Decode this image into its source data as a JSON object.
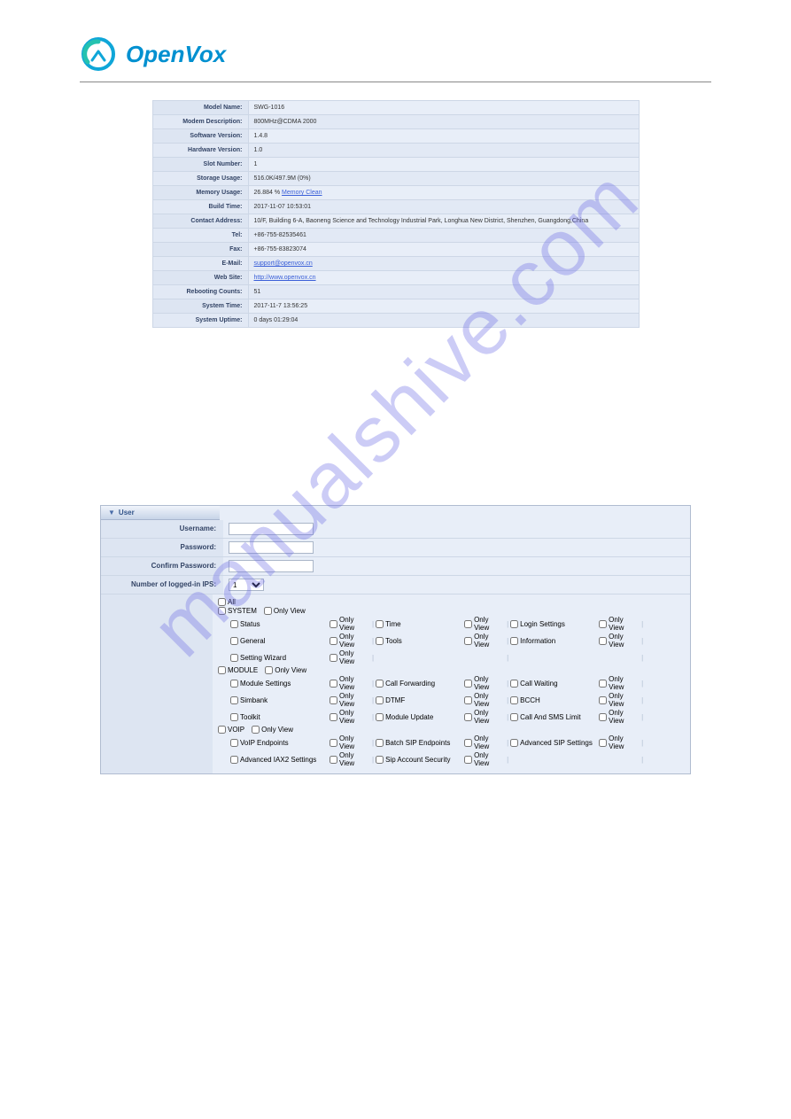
{
  "brand": "OpenVox",
  "watermark": "manualshive.com",
  "info_rows": [
    {
      "label": "Model Name:",
      "value": "SWG-1016"
    },
    {
      "label": "Modem Description:",
      "value": "800MHz@CDMA 2000"
    },
    {
      "label": "Software Version:",
      "value": "1.4.8"
    },
    {
      "label": "Hardware Version:",
      "value": "1.0"
    },
    {
      "label": "Slot Number:",
      "value": "1"
    },
    {
      "label": "Storage Usage:",
      "value": "516.0K/497.9M (0%)"
    },
    {
      "label": "Memory Usage:",
      "value": "26.884 %",
      "link": "Memory Clean"
    },
    {
      "label": "Build Time:",
      "value": "2017-11-07 10:53:01"
    },
    {
      "label": "Contact Address:",
      "value": "10/F, Building 6-A, Baoneng Science and Technology Industrial Park, Longhua New District, Shenzhen, Guangdong,China"
    },
    {
      "label": "Tel:",
      "value": "+86-755-82535461"
    },
    {
      "label": "Fax:",
      "value": "+86-755-83823074"
    },
    {
      "label": "E-Mail:",
      "value": "",
      "link": "support@openvox.cn"
    },
    {
      "label": "Web Site:",
      "value": "",
      "link": "http://www.openvox.cn"
    },
    {
      "label": "Rebooting Counts:",
      "value": "51"
    },
    {
      "label": "System Time:",
      "value": "2017-11-7 13:56:25"
    },
    {
      "label": "System Uptime:",
      "value": "0 days 01:29:04"
    }
  ],
  "user_panel": {
    "title": "User",
    "fields": {
      "username": "Username:",
      "password": "Password:",
      "confirm": "Confirm Password:",
      "ips": "Number of logged-in IPS:",
      "ips_value": "1"
    },
    "perm": {
      "all": "All",
      "only_view": "Only View",
      "groups": [
        {
          "name": "SYSTEM",
          "rows": [
            [
              "Status",
              "Time",
              "Login Settings"
            ],
            [
              "General",
              "Tools",
              "Information"
            ],
            [
              "Setting Wizard",
              "",
              ""
            ]
          ]
        },
        {
          "name": "MODULE",
          "rows": [
            [
              "Module Settings",
              "Call Forwarding",
              "Call Waiting"
            ],
            [
              "Simbank",
              "DTMF",
              "BCCH"
            ],
            [
              "Toolkit",
              "Module Update",
              "Call And SMS Limit"
            ]
          ]
        },
        {
          "name": "VOIP",
          "rows": [
            [
              "VoIP Endpoints",
              "Batch SIP Endpoints",
              "Advanced SIP Settings"
            ],
            [
              "Advanced IAX2 Settings",
              "Sip Account Security",
              ""
            ]
          ]
        }
      ]
    }
  }
}
